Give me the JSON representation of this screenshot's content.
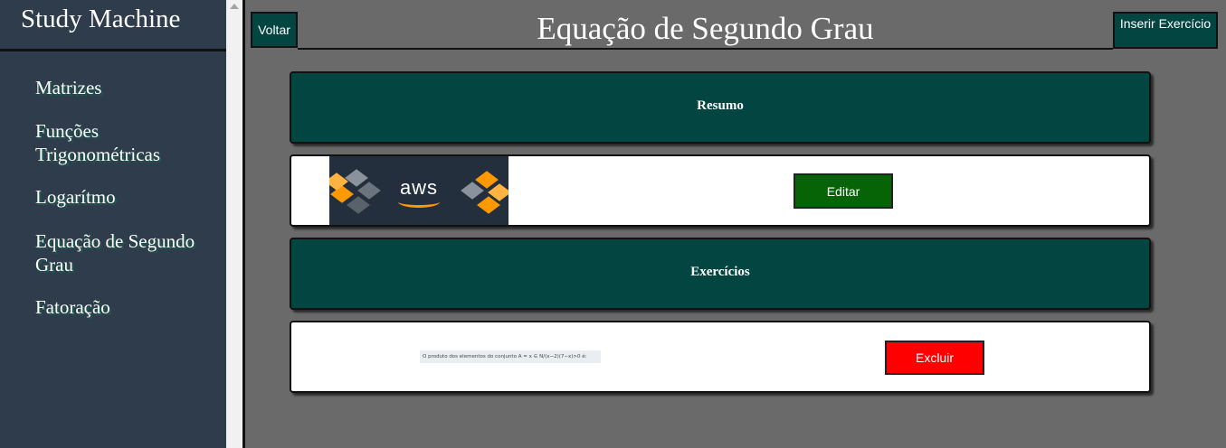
{
  "app": {
    "brand": "Study Machine"
  },
  "sidebar": {
    "items": [
      {
        "label": "Matrizes"
      },
      {
        "label": "Funções Trigonométricas"
      },
      {
        "label": "Logarítmo"
      },
      {
        "label": "Equação de Segundo Grau"
      },
      {
        "label": "Fatoração"
      }
    ]
  },
  "header": {
    "back_label": "Voltar",
    "title": "Equação de Segundo Grau",
    "insert_label": "Inserir Exercício"
  },
  "summary": {
    "heading": "Resumo",
    "image_text": "aws",
    "edit_label": "Editar"
  },
  "exercises": {
    "heading": "Exercícios",
    "items": [
      {
        "preview_text": "O produto dos elementos do conjunto A = x ∈ N/(x−2)(7−x)>0 é:",
        "delete_label": "Excluir"
      }
    ]
  },
  "colors": {
    "sidebar_bg": "#2e3c4b",
    "accent_dark": "#034541",
    "edit_green": "#066306",
    "delete_red": "#ff0000",
    "main_bg": "#6a6a6a",
    "aws_orange": "#ff9900"
  },
  "icons": {
    "scroll_up": "triangle-up-icon"
  }
}
